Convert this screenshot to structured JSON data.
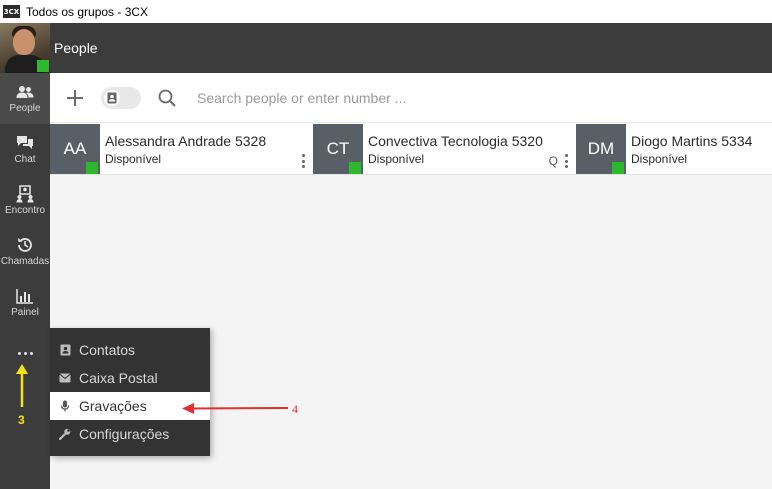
{
  "window": {
    "app_icon_text": "3CX",
    "title": "Todos os grupos - 3CX"
  },
  "sidebar": {
    "items": [
      {
        "label": "People",
        "icon": "people-icon",
        "active": true
      },
      {
        "label": "Chat",
        "icon": "chat-icon",
        "active": false
      },
      {
        "label": "Encontro",
        "icon": "meeting-icon",
        "active": false
      },
      {
        "label": "Chamadas",
        "icon": "history-icon",
        "active": false
      },
      {
        "label": "Painel",
        "icon": "chart-icon",
        "active": false
      }
    ],
    "more_icon": "more-dots-icon"
  },
  "header": {
    "title": "People"
  },
  "toolbar": {
    "add_icon": "plus-icon",
    "toggle_icon": "contact-card-icon",
    "search_icon": "search-icon",
    "search_placeholder": "Search people or enter number ..."
  },
  "contacts": [
    {
      "initials": "AA",
      "name": "Alessandra Andrade 5328",
      "status": "Disponível",
      "show_q": false
    },
    {
      "initials": "CT",
      "name": "Convectiva Tecnologia 5320",
      "status": "Disponível",
      "show_q": true,
      "q_label": "Q"
    },
    {
      "initials": "DM",
      "name": "Diogo Martins 5334",
      "status": "Disponível",
      "show_q": false
    }
  ],
  "menu": {
    "items": [
      {
        "label": "Contatos",
        "icon": "contact-card-icon"
      },
      {
        "label": "Caixa Postal",
        "icon": "envelope-icon"
      },
      {
        "label": "Gravações",
        "icon": "microphone-icon",
        "highlighted": true
      },
      {
        "label": "Configurações",
        "icon": "wrench-icon"
      }
    ]
  },
  "annotations": {
    "step3": "3",
    "step4": "4"
  },
  "colors": {
    "presence_available": "#2db82d",
    "sidebar_bg": "#3c3c3c",
    "annotation_yellow": "#f5e21b",
    "annotation_red": "#e03030"
  }
}
